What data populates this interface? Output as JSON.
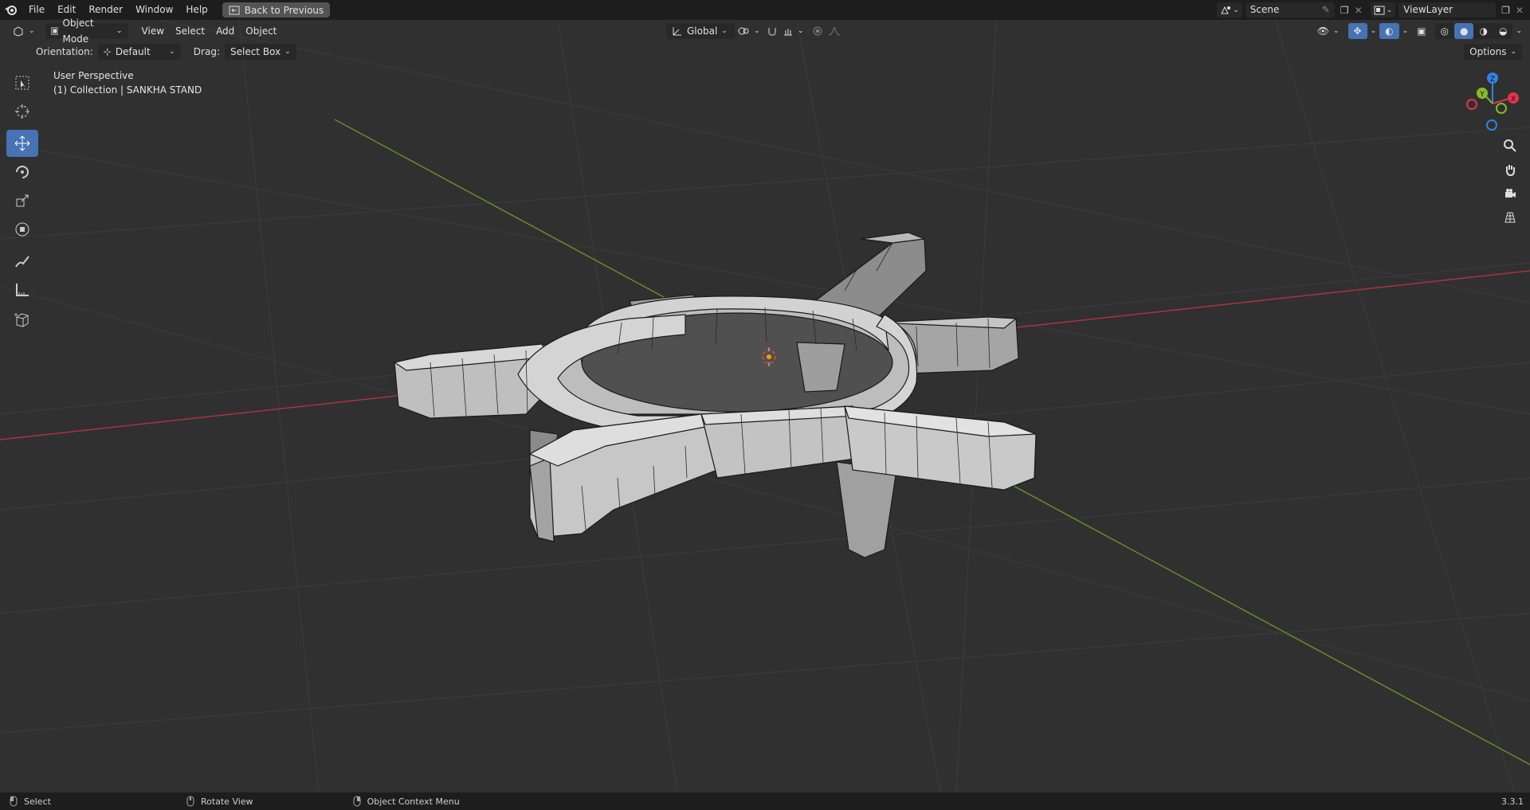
{
  "topbar": {
    "menus": [
      "File",
      "Edit",
      "Render",
      "Window",
      "Help"
    ],
    "back_label": "Back to Previous",
    "scene": "Scene",
    "view_layer": "ViewLayer"
  },
  "header": {
    "mode": "Object Mode",
    "menus": [
      "View",
      "Select",
      "Add",
      "Object"
    ],
    "transform_orientation": "Global",
    "options_label": "Options"
  },
  "subheader": {
    "orientation_label": "Orientation:",
    "orientation_value": "Default",
    "drag_label": "Drag:",
    "drag_value": "Select Box"
  },
  "viewport": {
    "perspective": "User Perspective",
    "collection": "(1) Collection | SANKHA STAND"
  },
  "gizmo": {
    "z": "Z",
    "y": "Y",
    "x": "X",
    "colors": {
      "x": "#e3344a",
      "y": "#87b92d",
      "z": "#2f83e3"
    }
  },
  "statusbar": {
    "select": "Select",
    "rotate": "Rotate View",
    "context": "Object Context Menu",
    "version": "3.3.1"
  },
  "colors": {
    "accent": "#4772b3",
    "background": "#303030",
    "mesh": "#c9c9c9"
  }
}
